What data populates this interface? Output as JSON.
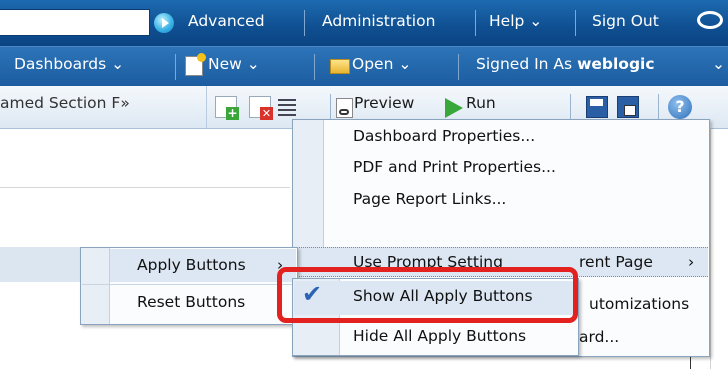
{
  "header": {
    "links": [
      "Advanced",
      "Administration",
      "Help",
      "Sign Out"
    ]
  },
  "menubar": {
    "dashboards": "Dashboards",
    "new": "New",
    "open": "Open",
    "signed_in_prefix": "Signed In As",
    "user": "weblogic"
  },
  "toolbar": {
    "section_tab": "amed Section F»",
    "preview": "Preview",
    "run": "Run"
  },
  "properties_menu": {
    "items": [
      "Dashboard Properties...",
      "PDF and Print Properties...",
      "Page Report Links...",
      "Use Prompt Setting",
      "rent Page",
      "utomizations",
      "ard..."
    ]
  },
  "apply_menu": {
    "items": [
      "Apply Buttons",
      "Reset Buttons"
    ]
  },
  "apply_submenu": {
    "items": [
      "Show All Apply Buttons",
      "Hide All Apply Buttons"
    ]
  },
  "colors": {
    "highlight_border": "#e3221f",
    "header_blue": "#0f4f91"
  }
}
